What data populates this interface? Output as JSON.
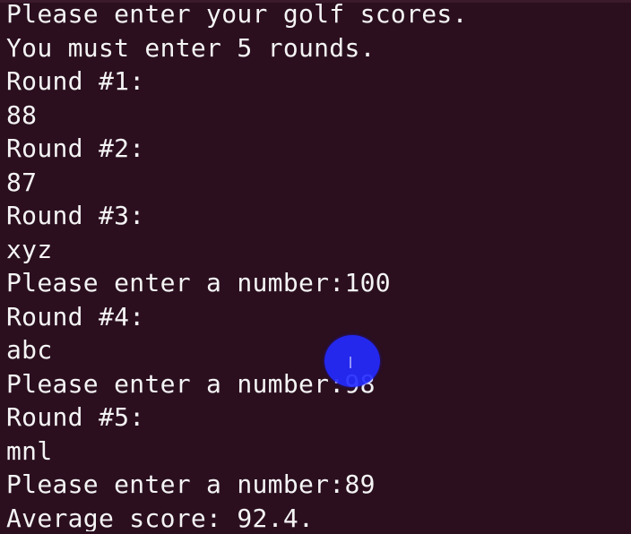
{
  "terminal": {
    "lines": [
      "Please enter your golf scores.",
      "You must enter 5 rounds.",
      "Round #1:",
      "88",
      "Round #2:",
      "87",
      "Round #3:",
      "xyz",
      "Please enter a number:100",
      "Round #4:",
      "abc",
      "Please enter a number:98",
      "Round #5:",
      "mnl",
      "Please enter a number:89",
      "Average score: 92.4."
    ]
  },
  "colors": {
    "background": "#2b0f1f",
    "text": "#f4f4f4",
    "cursor_highlight": "#2430ff"
  }
}
